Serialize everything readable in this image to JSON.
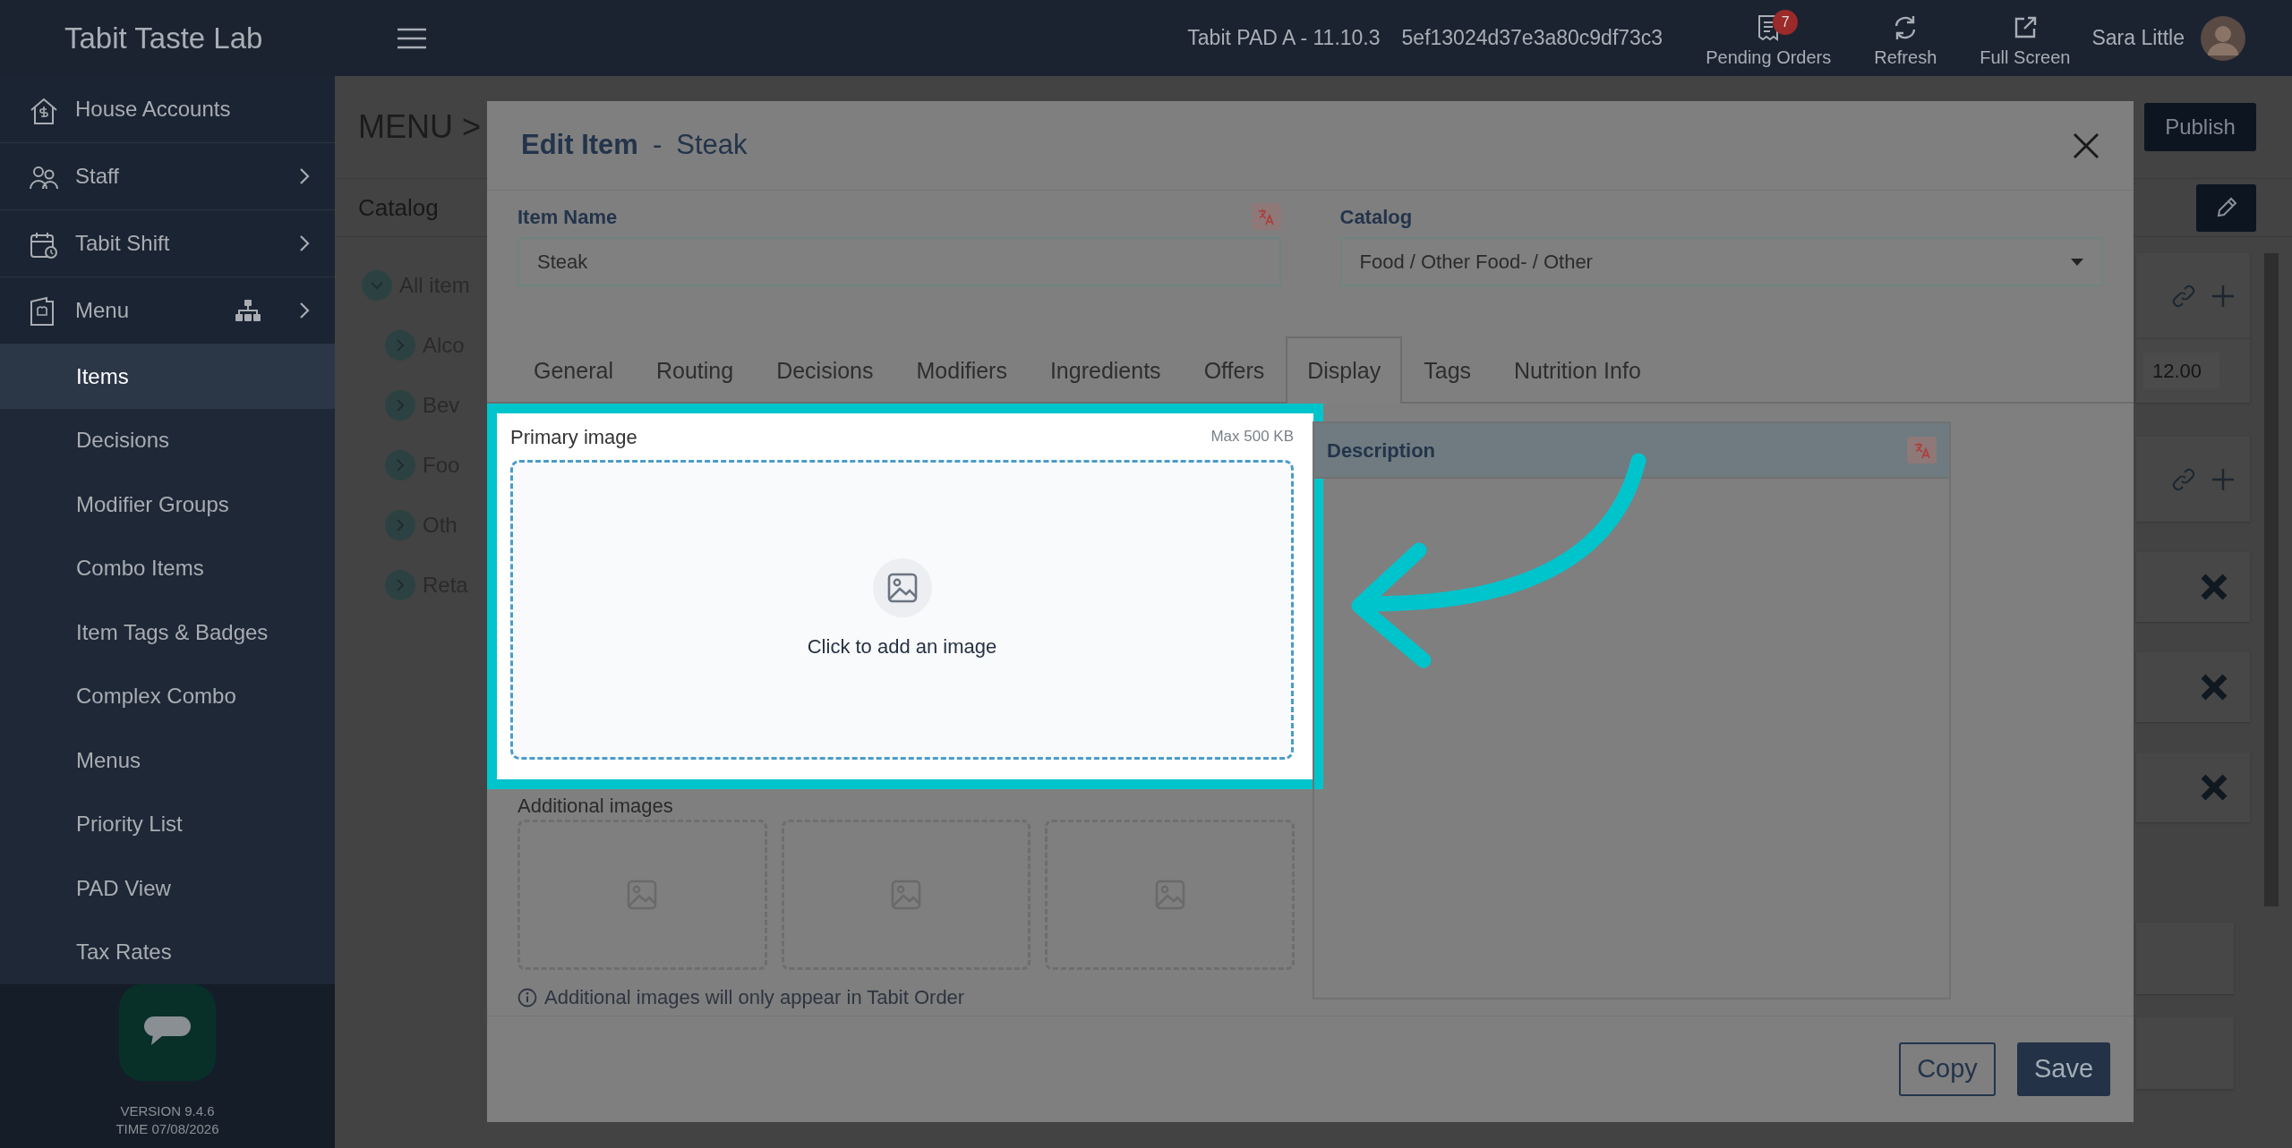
{
  "topbar": {
    "brand": "Tabit Taste Lab",
    "device": "Tabit PAD A - 11.10.3",
    "device_id": "5ef13024d37e3a80c9df73c3",
    "actions": [
      {
        "label": "Pending Orders",
        "badge": "7"
      },
      {
        "label": "Refresh"
      },
      {
        "label": "Full Screen"
      }
    ],
    "user": "Sara Little"
  },
  "sidebar": {
    "items": [
      {
        "label": "House Accounts",
        "expandable": false
      },
      {
        "label": "Staff",
        "expandable": true
      },
      {
        "label": "Tabit Shift",
        "expandable": true
      },
      {
        "label": "Menu",
        "expandable": true,
        "children": [
          {
            "label": "Items",
            "selected": true
          },
          {
            "label": "Decisions",
            "selected": false
          },
          {
            "label": "Modifier Groups",
            "selected": false
          },
          {
            "label": "Combo Items",
            "selected": false
          },
          {
            "label": "Item Tags & Badges",
            "selected": false
          },
          {
            "label": "Complex Combo",
            "selected": false
          },
          {
            "label": "Menus",
            "selected": false
          },
          {
            "label": "Priority List",
            "selected": false
          },
          {
            "label": "PAD View",
            "selected": false
          },
          {
            "label": "Tax Rates",
            "selected": false
          }
        ]
      }
    ],
    "version": "VERSION 9.4.6",
    "time": "TIME 07/08/2026"
  },
  "page": {
    "title": "MENU >",
    "publish": "Publish",
    "catalog_label": "Catalog",
    "tree": [
      {
        "label": "All item",
        "expanded": true,
        "children": [
          {
            "label": "Alco",
            "expanded": false
          },
          {
            "label": "Bev",
            "expanded": false
          },
          {
            "label": "Foo",
            "expanded": false
          },
          {
            "label": "Oth",
            "expanded": false
          },
          {
            "label": "Reta",
            "expanded": false
          }
        ]
      }
    ],
    "right_rows": [
      {
        "kind": "actions"
      },
      {
        "kind": "price",
        "value": "12.00"
      },
      {
        "kind": "actions"
      },
      {
        "kind": "remove"
      },
      {
        "kind": "remove"
      },
      {
        "kind": "remove"
      },
      {
        "kind": "blank"
      },
      {
        "kind": "blank"
      }
    ]
  },
  "modal": {
    "title": "Edit Item",
    "separator": "-",
    "subtitle": "Steak",
    "fields": [
      {
        "label": "Item Name",
        "value": "Steak",
        "kind": "text",
        "translatable": true
      },
      {
        "label": "Catalog",
        "value": "Food / Other Food- / Other",
        "kind": "select",
        "translatable": false
      }
    ],
    "tabs": [
      {
        "label": "General",
        "selected": false
      },
      {
        "label": "Routing",
        "selected": false
      },
      {
        "label": "Decisions",
        "selected": false
      },
      {
        "label": "Modifiers",
        "selected": false
      },
      {
        "label": "Ingredients",
        "selected": false
      },
      {
        "label": "Offers",
        "selected": false
      },
      {
        "label": "Display",
        "selected": true
      },
      {
        "label": "Tags",
        "selected": false
      },
      {
        "label": "Nutrition Info",
        "selected": false
      }
    ],
    "primary_image": {
      "label": "Primary image",
      "limit": "Max 500 KB",
      "prompt": "Click to add an image",
      "highlighted": true
    },
    "additional_images": {
      "label": "Additional images",
      "slots": [
        {
          "kind": "empty"
        },
        {
          "kind": "empty"
        },
        {
          "kind": "empty"
        }
      ],
      "note": "Additional images will only appear in Tabit Order"
    },
    "description": {
      "label": "Description",
      "translatable": true
    },
    "buttons": [
      {
        "label": "Copy",
        "kind": "outline"
      },
      {
        "label": "Save",
        "kind": "primary"
      }
    ]
  }
}
